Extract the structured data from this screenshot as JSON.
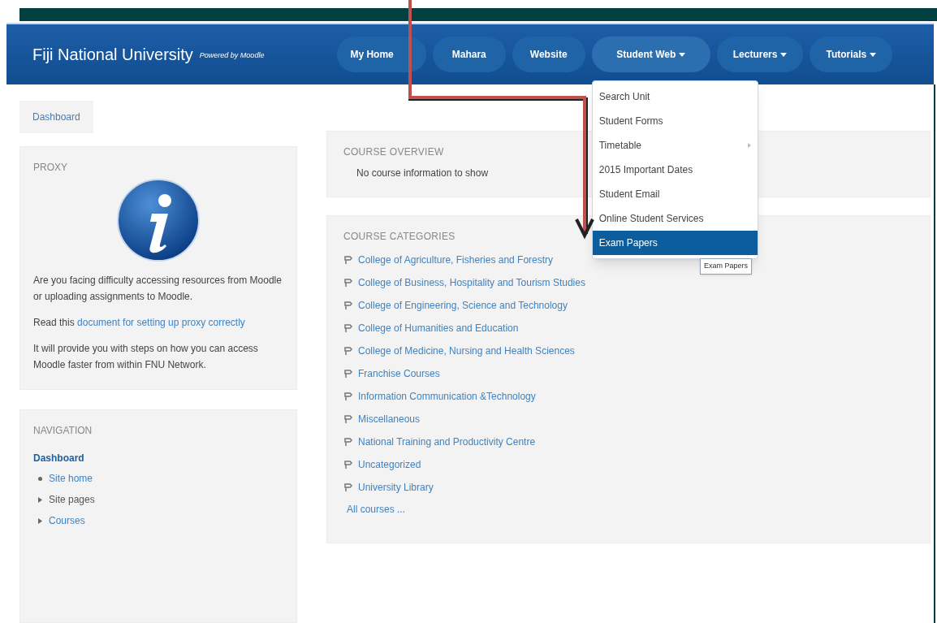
{
  "navbar": {
    "brand": "Fiji National University",
    "tagline": "Powered by Moodle",
    "items": [
      {
        "label": "My Home",
        "dropdown": false,
        "open": false
      },
      {
        "label": "Mahara",
        "dropdown": false,
        "open": false
      },
      {
        "label": "Website",
        "dropdown": false,
        "open": false
      },
      {
        "label": "Student Web",
        "dropdown": true,
        "open": true
      },
      {
        "label": "Lecturers",
        "dropdown": true,
        "open": false
      },
      {
        "label": "Tutorials",
        "dropdown": true,
        "open": false
      }
    ]
  },
  "dropdown_menu": {
    "items": [
      {
        "label": "Search Unit",
        "selected": false,
        "submenu": false
      },
      {
        "label": "Student Forms",
        "selected": false,
        "submenu": false
      },
      {
        "label": "Timetable",
        "selected": false,
        "submenu": true
      },
      {
        "label": "2015 Important Dates",
        "selected": false,
        "submenu": false
      },
      {
        "label": "Student Email",
        "selected": false,
        "submenu": false
      },
      {
        "label": "Online Student Services",
        "selected": false,
        "submenu": false
      },
      {
        "label": "Exam Papers",
        "selected": true,
        "submenu": false
      }
    ],
    "tooltip": "Exam Papers"
  },
  "breadcrumb": [
    "Dashboard"
  ],
  "proxy_block": {
    "title": "PROXY",
    "paragraph_1": "Are you facing difficulty accessing resources from Moodle or uploading assignments to Moodle.",
    "paragraph_2": "Read this",
    "link": "document for setting up proxy correctly",
    "paragraph_3": "It will provide you with steps on how you can access Moodle faster from within FNU Network."
  },
  "navigation_block": {
    "title": "NAVIGATION",
    "root": "Dashboard",
    "children": [
      {
        "label": "Site home",
        "kind": "leaf",
        "link": true
      },
      {
        "label": "Site pages",
        "kind": "branch",
        "link": false
      },
      {
        "label": "Courses",
        "kind": "branch",
        "link": true
      }
    ]
  },
  "course_overview": {
    "title": "COURSE OVERVIEW",
    "message": "No course information to show"
  },
  "course_categories": {
    "title": "COURSE CATEGORIES",
    "items": [
      "College of Agriculture, Fisheries and Forestry",
      "College of Business, Hospitality and Tourism Studies",
      "College of Engineering, Science and Technology",
      "College of Humanities and Education",
      "College of Medicine, Nursing and Health Sciences",
      "Franchise Courses",
      "Information Communication &Technology",
      "Miscellaneous",
      "National Training and Productivity Centre",
      "Uncategorized",
      "University Library"
    ],
    "all_link": "All courses ..."
  }
}
